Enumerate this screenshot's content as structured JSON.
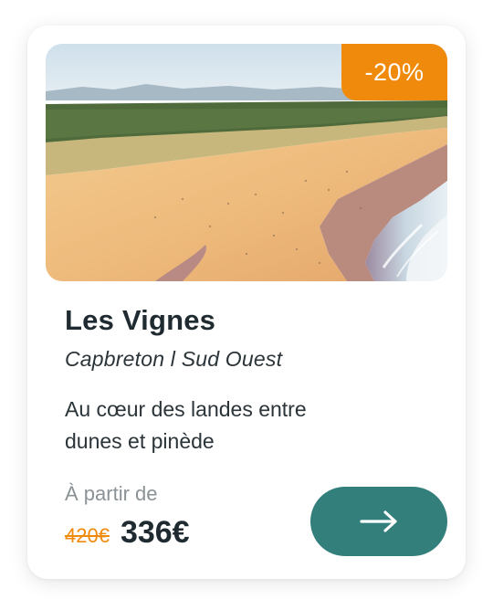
{
  "card": {
    "image_alt": "Aerial view of beach, dunes and pine forest",
    "discount": "-20%",
    "title": "Les Vignes",
    "location": "Capbreton l Sud Ouest",
    "description": "Au cœur des landes entre dunes et pinède",
    "price_prefix": "À partir de",
    "old_price": "420€",
    "new_price": "336€",
    "button_icon": "arrow-right-icon"
  },
  "colors": {
    "accent_orange": "#f08a0c",
    "button_teal": "#337f7b",
    "title_dark": "#1f2b30",
    "muted_grey": "#8b9296"
  }
}
